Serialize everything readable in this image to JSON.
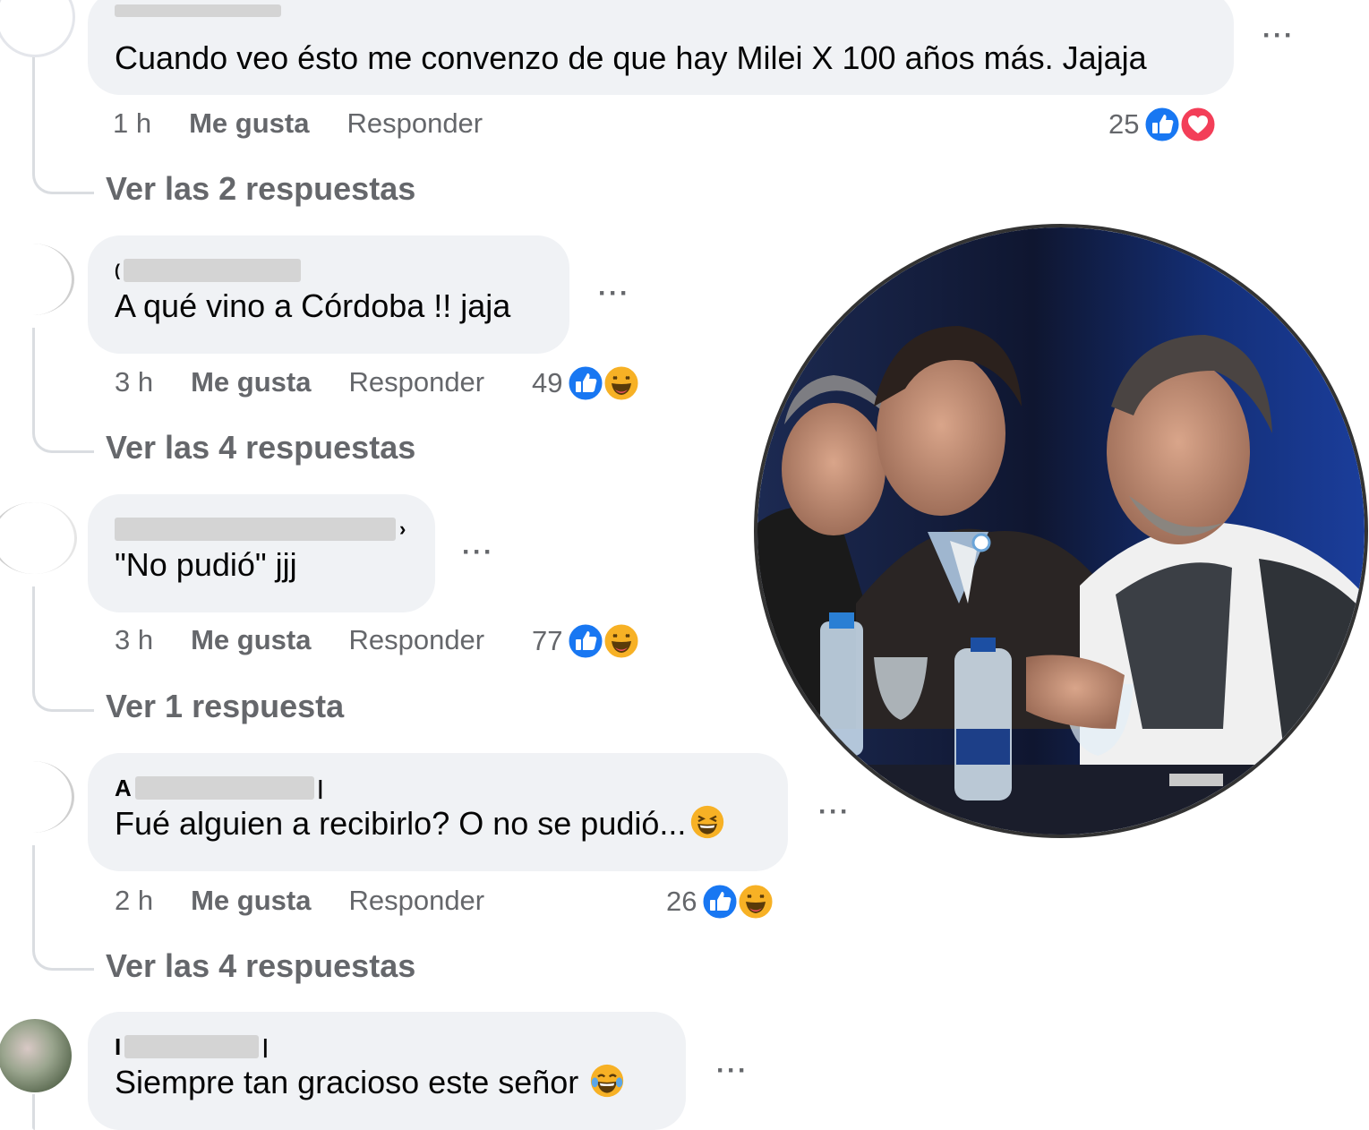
{
  "comments": [
    {
      "author_initial": "",
      "author_tail": "",
      "text": "Cuando veo ésto me convenzo de que hay Milei X 100 años más. Jajaja",
      "time": "1 h",
      "like_label": "Me gusta",
      "reply_label": "Responder",
      "reaction_count": "25",
      "reactions": [
        "like-icon",
        "love-icon"
      ],
      "view_replies": "Ver las 2 respuestas"
    },
    {
      "author_initial": "(",
      "author_tail": "",
      "text": "A qué vino a Córdoba !! jaja",
      "time": "3 h",
      "like_label": "Me gusta",
      "reply_label": "Responder",
      "reaction_count": "49",
      "reactions": [
        "like-icon",
        "haha-icon"
      ],
      "view_replies": "Ver las 4 respuestas"
    },
    {
      "author_initial": "",
      "author_tail": "›",
      "text": "\"No pudió\" jjj",
      "time": "3 h",
      "like_label": "Me gusta",
      "reply_label": "Responder",
      "reaction_count": "77",
      "reactions": [
        "like-icon",
        "haha-icon"
      ],
      "view_replies": "Ver 1 respuesta"
    },
    {
      "author_initial": "A",
      "author_tail": "",
      "text": "Fué alguien a recibirlo? O no se pudió...",
      "text_emoji": "laughing-emoji",
      "time": "2 h",
      "like_label": "Me gusta",
      "reply_label": "Responder",
      "reaction_count": "26",
      "reactions": [
        "like-icon",
        "haha-icon"
      ],
      "view_replies": "Ver las 4 respuestas"
    },
    {
      "author_initial": "I",
      "author_tail": "",
      "text": "Siempre tan gracioso este señor",
      "text_emoji": "tears-of-joy-emoji"
    }
  ],
  "more_label": "···",
  "colors": {
    "bubble": "#f0f2f5",
    "meta": "#65676b",
    "like_blue": "#1877f2",
    "love_red": "#f33e58",
    "haha_yellow": "#f7b125"
  }
}
